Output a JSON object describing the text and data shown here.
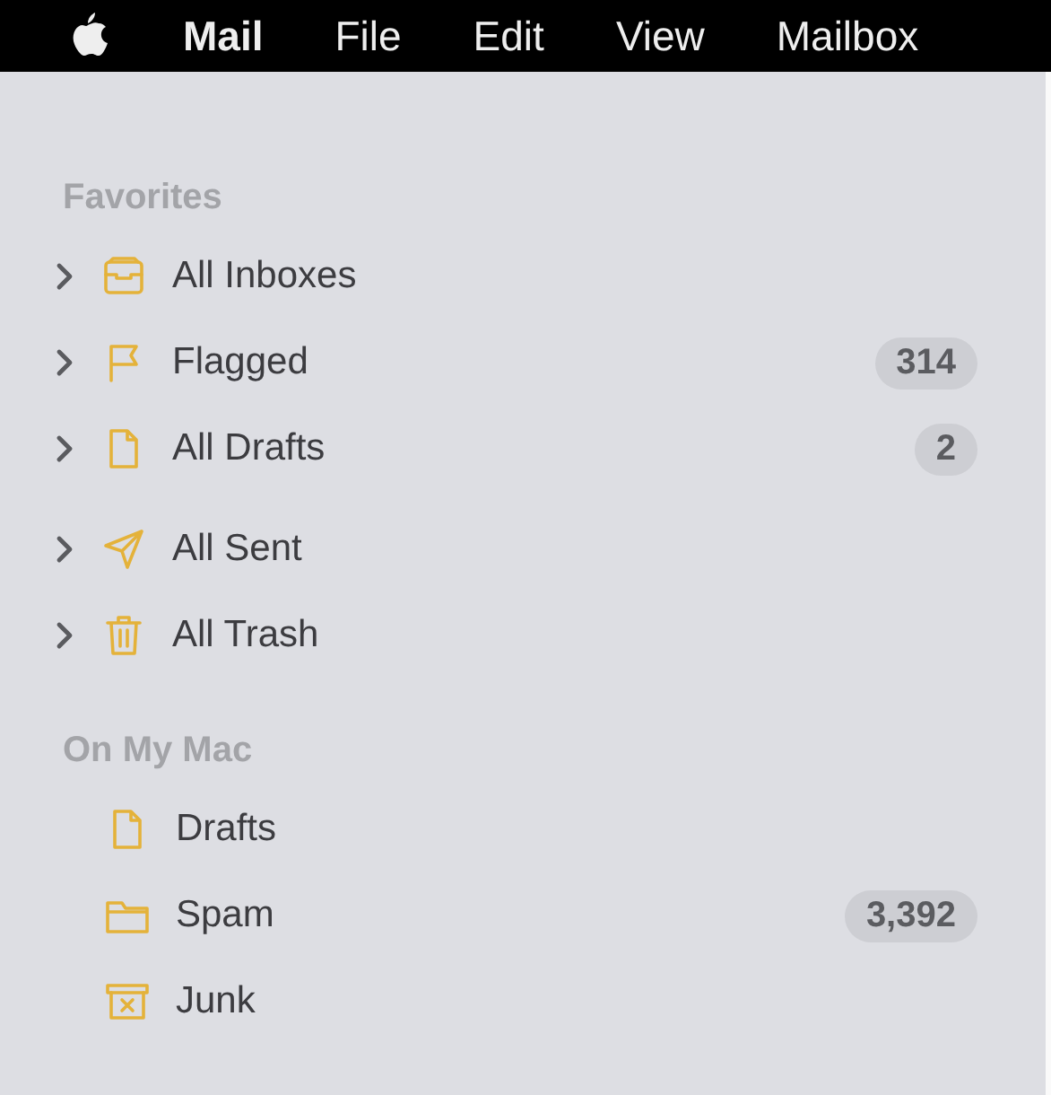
{
  "menu_bar": {
    "items": [
      {
        "label": "Mail",
        "bold": true
      },
      {
        "label": "File",
        "bold": false
      },
      {
        "label": "Edit",
        "bold": false
      },
      {
        "label": "View",
        "bold": false
      },
      {
        "label": "Mailbox",
        "bold": false
      }
    ]
  },
  "sidebar": {
    "sections": [
      {
        "title": "Favorites",
        "items": [
          {
            "label": "All Inboxes",
            "expanded": false
          },
          {
            "label": "Flagged",
            "expanded": false,
            "count": "314"
          },
          {
            "label": "All Drafts",
            "expanded": false,
            "count": "2"
          },
          {
            "label": "All Sent",
            "expanded": false
          },
          {
            "label": "All Trash",
            "expanded": false
          }
        ]
      },
      {
        "title": "On My Mac",
        "items": [
          {
            "label": "Drafts"
          },
          {
            "label": "Spam",
            "count": "3,392"
          },
          {
            "label": "Junk"
          }
        ]
      }
    ]
  }
}
